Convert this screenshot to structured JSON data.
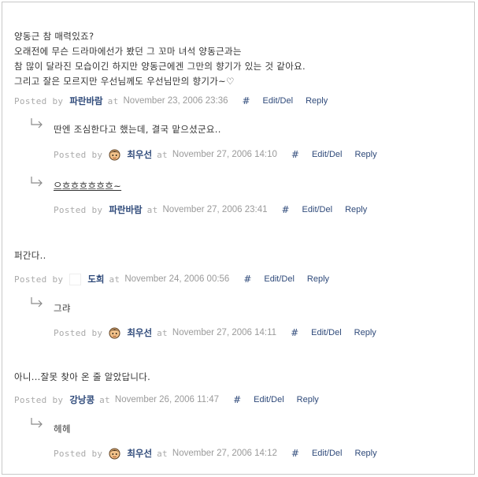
{
  "labels": {
    "posted_by": "Posted by",
    "at": "at",
    "hash": "#",
    "edit": "Edit/Del",
    "reply": "Reply"
  },
  "comments": [
    {
      "lines": [
        "양동근 참 매력있죠?",
        "오래전에 무슨 드라마에선가 봤던 그 꼬마 녀석 양동근과는",
        "참 많이 달라진 모습이긴 하지만 양동근에겐 그만의 향기가 있는 것 같아요.",
        "그리고 잘은 모르지만 우선님께도 우선님만의 향기가~♡"
      ],
      "author": "파란바람",
      "date": "November 23, 2006 23:36",
      "replies": [
        {
          "text": "딴엔 조심한다고 했는데, 결국 맡으셨군요..",
          "author": "최우선",
          "date": "November 27, 2006 14:10",
          "avatar": true
        },
        {
          "text": "으흐흐흐흐흐흐~",
          "author": "파란바람",
          "date": "November 27, 2006 23:41",
          "avatar": false
        }
      ]
    },
    {
      "lines": [
        "퍼간다.."
      ],
      "author": "도희",
      "date": "November 24, 2006 00:56",
      "replies": [
        {
          "text": "그랴",
          "author": "최우선",
          "date": "November 27, 2006 14:11",
          "avatar": true
        }
      ]
    },
    {
      "lines": [
        "아니...잘못 찾아 온 줄 알았답니다."
      ],
      "author": "강낭콩",
      "date": "November 26, 2006 11:47",
      "replies": [
        {
          "text": "헤헤",
          "author": "최우선",
          "date": "November 27, 2006 14:12",
          "avatar": true
        }
      ]
    }
  ]
}
